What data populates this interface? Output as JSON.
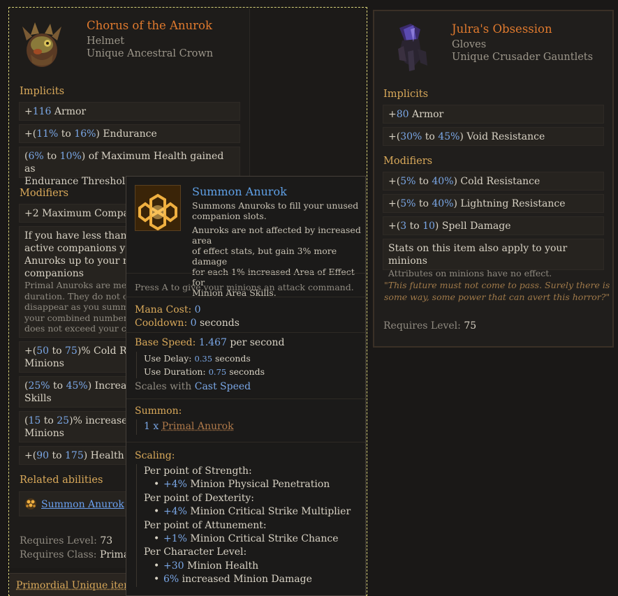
{
  "left_item": {
    "name": "Chorus of the Anurok",
    "slot": "Helmet",
    "base": "Unique Ancestral Crown",
    "implicits_heading": "Implicits",
    "implicits": [
      {
        "pre": "+",
        "num": "116",
        "post": " Armor"
      },
      {
        "pre": "+(",
        "num": "11%",
        "mid": " to ",
        "num2": "16%",
        "post": ") Endurance"
      },
      {
        "pre": "(",
        "num": "6%",
        "mid": " to ",
        "num2": "10%",
        "post": ") of Maximum Health gained as",
        "line2": "Endurance Threshold"
      }
    ],
    "modifiers_heading": "Modifiers",
    "mod_max_companions": {
      "pre": "+2",
      "post": " Maximum Compani"
    },
    "mod_block": {
      "l1": "If you have less than yo",
      "l2": "active companions you",
      "l3": "Anuroks up to your ma",
      "l4": "companions",
      "s1": "Primal Anuroks are melee",
      "s2": "duration. They do not cou",
      "s3": "disappear as you summon",
      "s4": "your combined number of",
      "s5": "does not exceed your com"
    },
    "mod_cold": {
      "pre": "+(",
      "num": "50",
      "mid": " to ",
      "num2": "75",
      "post": ")% Cold Resis",
      "line2": "Minions"
    },
    "mod_increased": {
      "pre": "(",
      "num": "25%",
      "mid": " to ",
      "num2": "45%",
      "post": ") Increased",
      "line2": "Skills"
    },
    "mod_area": {
      "pre": "(",
      "num": "15",
      "mid": " to ",
      "num2": "25",
      "post": ")% increased A",
      "line2": "Minions"
    },
    "mod_health": {
      "pre": "+(",
      "num": "90",
      "mid": " to ",
      "num2": "175",
      "post": ") Health"
    },
    "related_heading": "Related abilities",
    "related_ability": "Summon Anurok",
    "requires_level_label": "Requires Level: ",
    "requires_level": "73",
    "requires_class_label": "Requires Class: ",
    "requires_class": "Primalist",
    "footer": "Primordial Unique item -"
  },
  "right_item": {
    "name": "Julra's Obsession",
    "slot": "Gloves",
    "base": "Unique Crusader Gauntlets",
    "implicits_heading": "Implicits",
    "implicits": [
      {
        "pre": "+",
        "num": "80",
        "post": " Armor"
      },
      {
        "pre": "+(",
        "num": "30%",
        "mid": " to ",
        "num2": "45%",
        "post": ") Void Resistance"
      }
    ],
    "modifiers_heading": "Modifiers",
    "modifiers": [
      {
        "pre": "+(",
        "num": "5%",
        "mid": " to ",
        "num2": "40%",
        "post": ") Cold Resistance"
      },
      {
        "pre": "+(",
        "num": "5%",
        "mid": " to ",
        "num2": "40%",
        "post": ") Lightning Resistance"
      },
      {
        "pre": "+(",
        "num": "3",
        "mid": " to ",
        "num2": "10",
        "post": ") Spell Damage"
      }
    ],
    "minion_mod": "Stats on this item also apply to your minions",
    "minion_note": "Attributes on minions have no effect.",
    "flavor_1": "\"This future must not come to pass. Surely there is",
    "flavor_2": "some way, some power that can avert this horror?\"",
    "requires_level_label": "Requires Level: ",
    "requires_level": "75"
  },
  "tooltip": {
    "title": "Summon Anurok",
    "desc_1": "Summons Anuroks to fill your unused",
    "desc_2": "companion slots.",
    "desc_3": "Anuroks are not affected by increased area",
    "desc_4": "of effect stats, but gain 3% more damage",
    "desc_5": "for each 1% increased Area of Effect for",
    "desc_6": "Minion Area Skills.",
    "command": "Press A to give your minions an attack command.",
    "mana_label": "Mana Cost: ",
    "mana": "0",
    "cooldown_label": "Cooldown: ",
    "cooldown": "0",
    "cooldown_unit": " seconds",
    "base_speed_label": "Base Speed: ",
    "base_speed": "1.467",
    "base_speed_unit": " per second",
    "use_delay_label": "Use Delay: ",
    "use_delay": "0.35",
    "use_delay_unit": " seconds",
    "use_duration_label": "Use Duration: ",
    "use_duration": "0.75",
    "use_duration_unit": " seconds",
    "scales_label": "Scales with ",
    "scales_stat": "Cast Speed",
    "summon_heading": "Summon:",
    "summon_count": "1 x ",
    "summon_name": "Primal Anurok",
    "scaling_heading": "Scaling:",
    "str_label": "Per point of Strength:",
    "str_num": "+4%",
    "str_text": " Minion Physical Penetration",
    "dex_label": "Per point of Dexterity:",
    "dex_num": "+4%",
    "dex_text": " Minion Critical Strike Multiplier",
    "att_label": "Per point of Attunement:",
    "att_num": "+1%",
    "att_text": " Minion Critical Strike Chance",
    "lvl_label": "Per Character Level:",
    "lvl_num1": "+30",
    "lvl_text1": " Minion Health",
    "lvl_num2": "6%",
    "lvl_text2": " increased Minion Damage"
  }
}
